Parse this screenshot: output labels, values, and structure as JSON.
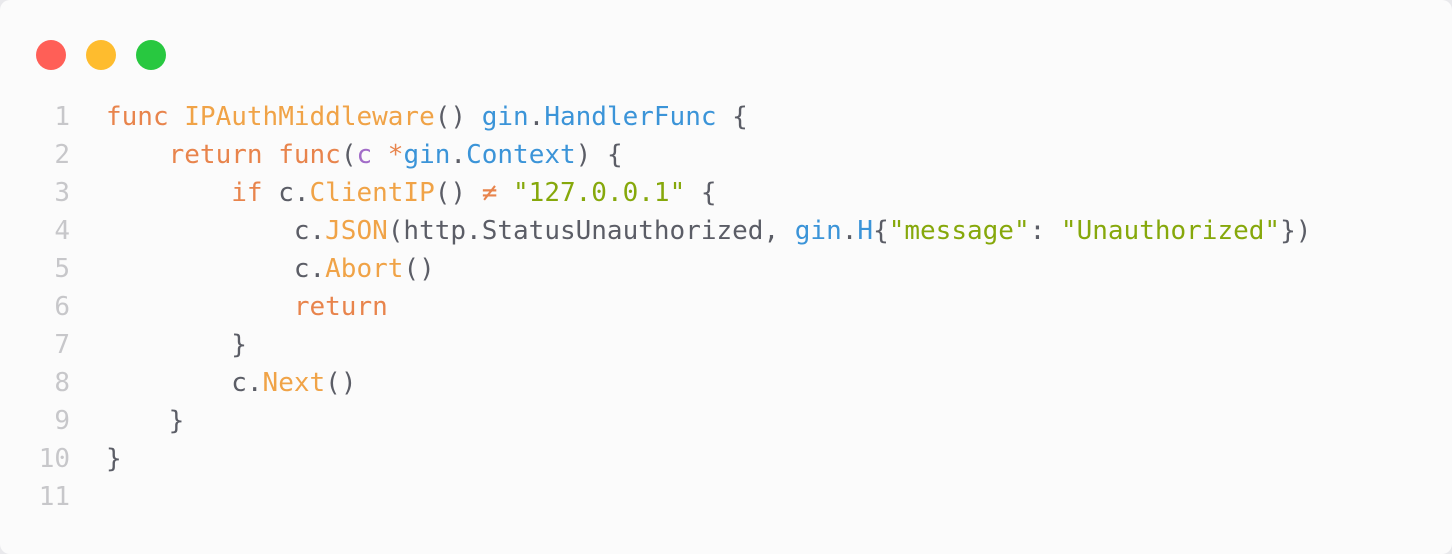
{
  "window": {
    "controls": [
      {
        "name": "close",
        "color": "#ff5f57"
      },
      {
        "name": "minimize",
        "color": "#febc2e"
      },
      {
        "name": "maximize",
        "color": "#28c840"
      }
    ]
  },
  "editor": {
    "language": "go",
    "lines": [
      {
        "number": "1",
        "tokens": [
          {
            "t": "func",
            "c": "kw"
          },
          {
            "t": " ",
            "c": "punc"
          },
          {
            "t": "IPAuthMiddleware",
            "c": "fn"
          },
          {
            "t": "()",
            "c": "punc"
          },
          {
            "t": " ",
            "c": "punc"
          },
          {
            "t": "gin",
            "c": "pkg"
          },
          {
            "t": ".",
            "c": "punc"
          },
          {
            "t": "HandlerFunc",
            "c": "pkg"
          },
          {
            "t": " {",
            "c": "punc"
          }
        ]
      },
      {
        "number": "2",
        "tokens": [
          {
            "t": "    ",
            "c": "punc"
          },
          {
            "t": "return",
            "c": "kw"
          },
          {
            "t": " ",
            "c": "punc"
          },
          {
            "t": "func",
            "c": "kw"
          },
          {
            "t": "(",
            "c": "punc"
          },
          {
            "t": "c",
            "c": "param"
          },
          {
            "t": " ",
            "c": "punc"
          },
          {
            "t": "*",
            "c": "op"
          },
          {
            "t": "gin",
            "c": "pkg"
          },
          {
            "t": ".",
            "c": "punc"
          },
          {
            "t": "Context",
            "c": "pkg"
          },
          {
            "t": ") {",
            "c": "punc"
          }
        ]
      },
      {
        "number": "3",
        "tokens": [
          {
            "t": "        ",
            "c": "punc"
          },
          {
            "t": "if",
            "c": "kw"
          },
          {
            "t": " c.",
            "c": "punc"
          },
          {
            "t": "ClientIP",
            "c": "fn"
          },
          {
            "t": "()",
            "c": "punc"
          },
          {
            "t": " ",
            "c": "punc"
          },
          {
            "t": "≠",
            "c": "op"
          },
          {
            "t": " ",
            "c": "punc"
          },
          {
            "t": "\"127.0.0.1\"",
            "c": "str"
          },
          {
            "t": " {",
            "c": "punc"
          }
        ]
      },
      {
        "number": "4",
        "tokens": [
          {
            "t": "            c.",
            "c": "punc"
          },
          {
            "t": "JSON",
            "c": "fn"
          },
          {
            "t": "(http.StatusUnauthorized, ",
            "c": "punc"
          },
          {
            "t": "gin",
            "c": "pkg"
          },
          {
            "t": ".",
            "c": "punc"
          },
          {
            "t": "H",
            "c": "pkg"
          },
          {
            "t": "{",
            "c": "punc"
          },
          {
            "t": "\"message\"",
            "c": "str"
          },
          {
            "t": ": ",
            "c": "punc"
          },
          {
            "t": "\"Unauthorized\"",
            "c": "str"
          },
          {
            "t": "})",
            "c": "punc"
          }
        ]
      },
      {
        "number": "5",
        "tokens": [
          {
            "t": "            c.",
            "c": "punc"
          },
          {
            "t": "Abort",
            "c": "fn"
          },
          {
            "t": "()",
            "c": "punc"
          }
        ]
      },
      {
        "number": "6",
        "tokens": [
          {
            "t": "            ",
            "c": "punc"
          },
          {
            "t": "return",
            "c": "kw"
          }
        ]
      },
      {
        "number": "7",
        "tokens": [
          {
            "t": "        }",
            "c": "punc"
          }
        ]
      },
      {
        "number": "8",
        "tokens": [
          {
            "t": "        c.",
            "c": "punc"
          },
          {
            "t": "Next",
            "c": "fn"
          },
          {
            "t": "()",
            "c": "punc"
          }
        ]
      },
      {
        "number": "9",
        "tokens": [
          {
            "t": "    }",
            "c": "punc"
          }
        ]
      },
      {
        "number": "10",
        "tokens": [
          {
            "t": "}",
            "c": "punc"
          }
        ]
      },
      {
        "number": "11",
        "tokens": []
      }
    ]
  }
}
